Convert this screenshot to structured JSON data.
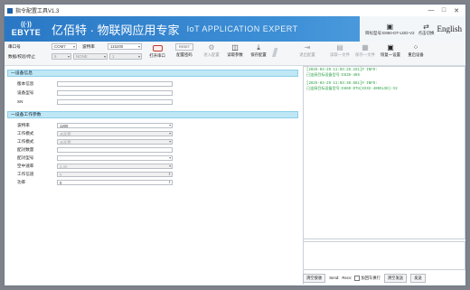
{
  "window": {
    "title": "指令配置工具V1.3"
  },
  "banner": {
    "logo_text": "EBYTE",
    "company": "亿佰特 · 物联网应用专家",
    "tagline": "IoT APPLICATION EXPERT",
    "model_label": "目标型号:E860-DT-LDD-V2",
    "lang_switch_label": "点击切换",
    "lang_button": "English"
  },
  "toolbar": {
    "port_label": "串口号",
    "port_value": "COM7",
    "baud_label": "波特率",
    "baud_value": "115200",
    "data_label": "数据/校验/停止",
    "data_value": "8",
    "parity_value": "NONE",
    "stop_value": "1",
    "open_port": "打开串口",
    "reset_label": "RESET",
    "buttons": [
      "配置密码",
      "进入配置",
      "读取参数",
      "保存配置",
      "退出配置",
      "读取一文件",
      "保存一文件",
      "恢复一设置",
      "重启设备"
    ]
  },
  "device_info": {
    "title": "一设备信息",
    "fields": [
      {
        "label": "版本信息",
        "value": ""
      },
      {
        "label": "设备型号",
        "value": ""
      },
      {
        "label": "SN",
        "value": ""
      }
    ]
  },
  "work_params": {
    "title": "一设备工作参数",
    "fields": [
      {
        "label": "波特率",
        "value": "1200"
      },
      {
        "label": "工作模式",
        "value": "未配置"
      },
      {
        "label": "工作模式",
        "value": "未配置"
      },
      {
        "label": "配对数量",
        "value": ""
      },
      {
        "label": "配对型号",
        "value": ""
      },
      {
        "label": "空中速率",
        "value": "2.4K"
      },
      {
        "label": "工作信道",
        "value": "0"
      },
      {
        "label": "功率",
        "value": "0"
      }
    ]
  },
  "log": {
    "lines": [
      "[2025-04-29 11:03:25.151]# INFO:",
      "已连接目标设备型号:E835-485",
      "",
      "[2025-04-29 11:03:40.561]# INFO:",
      "已连接目标设备型号:E860-DTU(XXXX-400SLSD)-V2"
    ]
  },
  "bottom": {
    "clear_log": "清空接收",
    "send_label": "Send:",
    "recv_label": "Recv:",
    "newline_label": "加回车换行",
    "clear_send": "清空发送",
    "send_button": "发送"
  }
}
